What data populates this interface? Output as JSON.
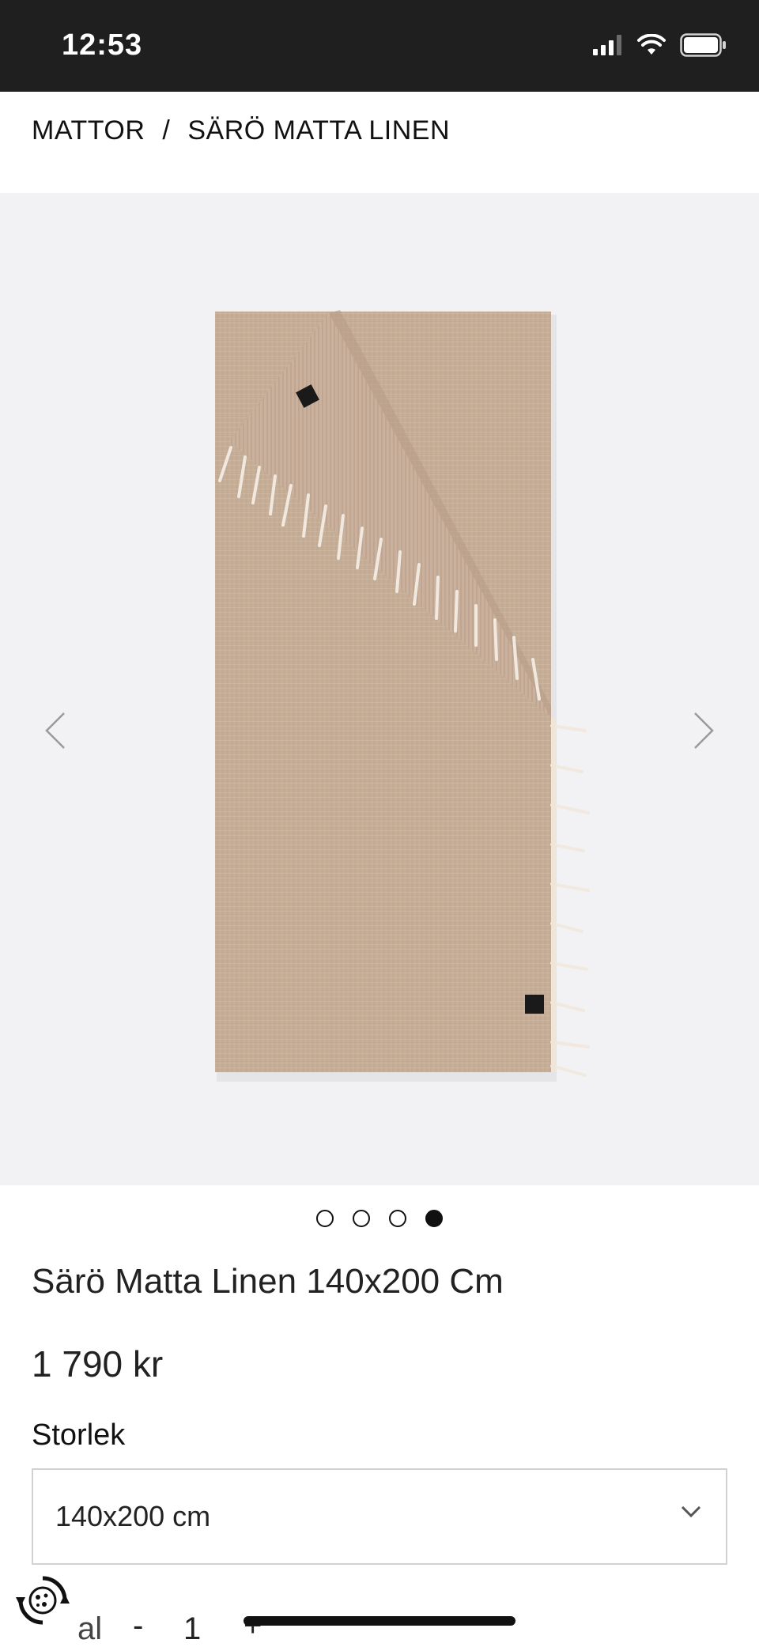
{
  "status_bar": {
    "time": "12:53",
    "icons": [
      "signal-icon",
      "wifi-icon",
      "battery-icon"
    ]
  },
  "breadcrumb": {
    "items": [
      "MATTOR",
      "SÄRÖ MATTA LINEN"
    ],
    "separator": "/"
  },
  "gallery": {
    "slide_count": 4,
    "active_index": 3,
    "prev_icon": "chevron-left-icon",
    "next_icon": "chevron-right-icon"
  },
  "product": {
    "title": "Särö Matta Linen 140x200 Cm",
    "price": "1 790 kr"
  },
  "size": {
    "label": "Storlek",
    "selected": "140x200 cm"
  },
  "quantity": {
    "label": "al",
    "minus": "-",
    "value": "1",
    "plus": "+"
  },
  "colors": {
    "status_bar_bg": "#1f1f1f",
    "gallery_bg": "#f2f1f4",
    "rug": "#c6ad97",
    "text": "#222222"
  }
}
